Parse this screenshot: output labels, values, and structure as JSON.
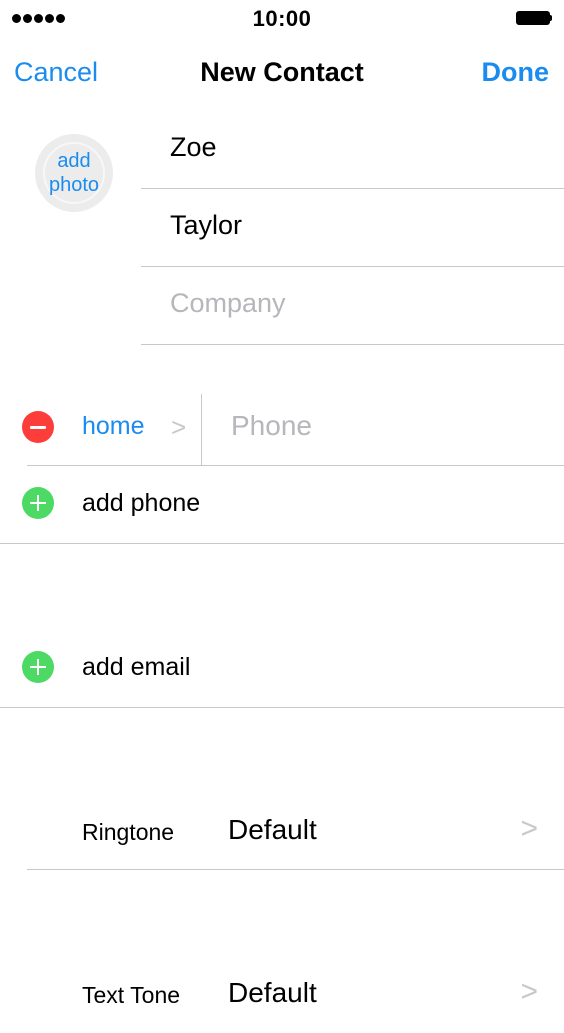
{
  "status_bar": {
    "time": "10:00"
  },
  "nav": {
    "cancel": "Cancel",
    "title": "New Contact",
    "done": "Done"
  },
  "photo": {
    "line1": "add",
    "line2": "photo"
  },
  "fields": {
    "first_name": "Zoe",
    "last_name": "Taylor",
    "company_placeholder": "Company"
  },
  "phone": {
    "label": "home",
    "chevron": ">",
    "placeholder": "Phone"
  },
  "add_phone": "add phone",
  "add_email": "add email",
  "ringtone": {
    "label": "Ringtone",
    "value": "Default",
    "chevron": ">"
  },
  "text_tone": {
    "label": "Text Tone",
    "value": "Default",
    "chevron": ">"
  },
  "colors": {
    "accent": "#1a8cf0",
    "delete": "#fc3d39",
    "add": "#4cd964",
    "placeholder": "#b6b6bb",
    "separator": "#c8c7cc"
  }
}
